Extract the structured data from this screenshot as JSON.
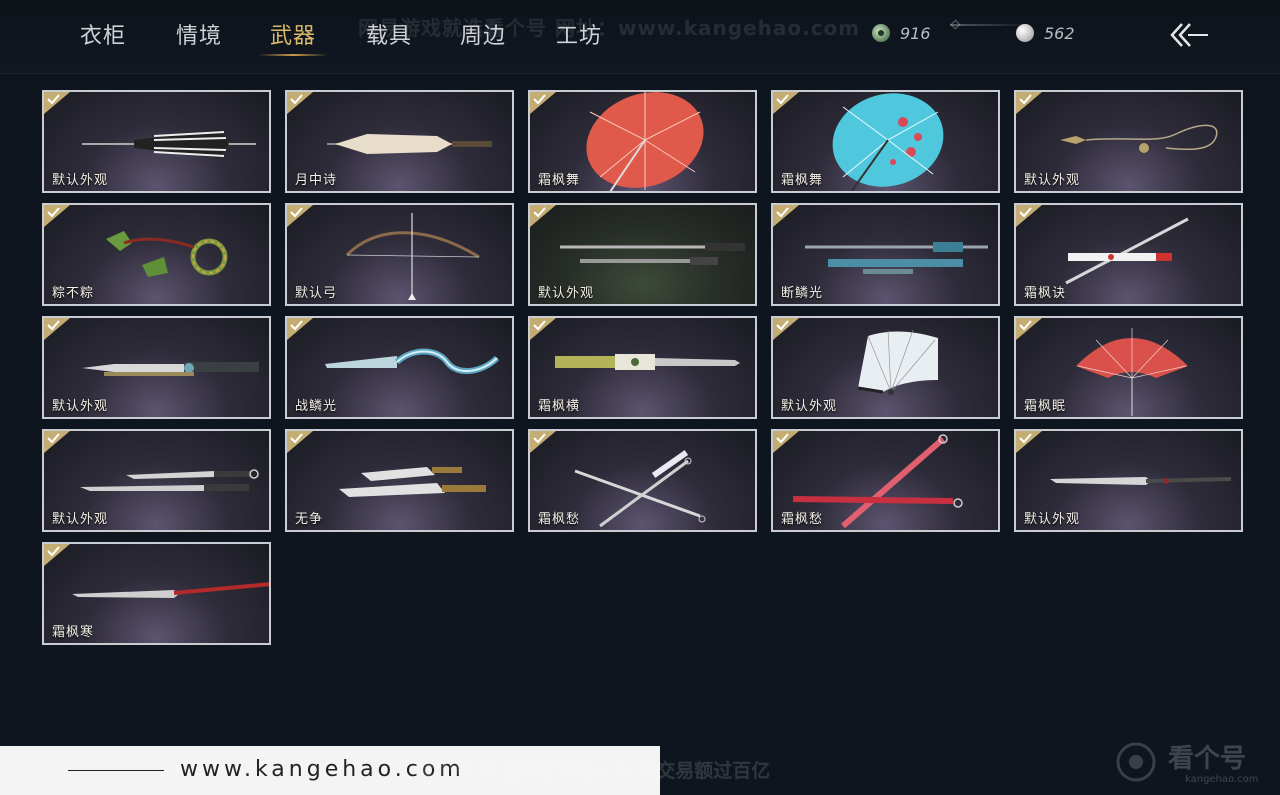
{
  "tabs": [
    {
      "label": "衣柜",
      "active": false
    },
    {
      "label": "情境",
      "active": false
    },
    {
      "label": "武器",
      "active": true
    },
    {
      "label": "载具",
      "active": false
    },
    {
      "label": "周边",
      "active": false
    },
    {
      "label": "工坊",
      "active": false
    }
  ],
  "watermark_top": "网易游戏就选看个号 网址：www.kangehao.com",
  "currency": {
    "jade": {
      "icon": "jade-coin-icon",
      "value": "916"
    },
    "silver": {
      "icon": "silver-coin-icon",
      "value": "562"
    }
  },
  "back_icon": "back-arrow-icon",
  "colors": {
    "accent": "#d9b86a",
    "check": "#c4ad72",
    "card_border": "#c9ccd1",
    "background": "#0f151f"
  },
  "items": [
    {
      "name": "默认外观",
      "icon": "umbrella-striped-icon",
      "owned": true
    },
    {
      "name": "月中诗",
      "icon": "umbrella-closed-white-icon",
      "owned": true
    },
    {
      "name": "霜枫舞",
      "icon": "umbrella-red-icon",
      "owned": true
    },
    {
      "name": "霜枫舞",
      "icon": "umbrella-blue-icon",
      "owned": true
    },
    {
      "name": "默认外观",
      "icon": "rope-dart-icon",
      "owned": true
    },
    {
      "name": "粽不粽",
      "icon": "zongzi-dart-icon",
      "owned": true
    },
    {
      "name": "默认弓",
      "icon": "bow-icon",
      "owned": true
    },
    {
      "name": "默认外观",
      "icon": "spear-pair-icon",
      "owned": true
    },
    {
      "name": "断鳞光",
      "icon": "spear-teal-icon",
      "owned": true
    },
    {
      "name": "霜枫诀",
      "icon": "spear-red-icon",
      "owned": true
    },
    {
      "name": "默认外观",
      "icon": "blade-long-icon",
      "owned": true
    },
    {
      "name": "战鳞光",
      "icon": "blade-dragon-icon",
      "owned": true
    },
    {
      "name": "霜枫横",
      "icon": "blade-jade-icon",
      "owned": true
    },
    {
      "name": "默认外观",
      "icon": "fan-white-icon",
      "owned": true
    },
    {
      "name": "霜枫眠",
      "icon": "fan-red-icon",
      "owned": true
    },
    {
      "name": "默认外观",
      "icon": "dual-sword-icon",
      "owned": true
    },
    {
      "name": "无争",
      "icon": "dual-sabre-icon",
      "owned": true
    },
    {
      "name": "霜枫愁",
      "icon": "cross-sword-white-icon",
      "owned": true
    },
    {
      "name": "霜枫愁",
      "icon": "cross-sword-red-icon",
      "owned": true
    },
    {
      "name": "默认外观",
      "icon": "long-blade-icon",
      "owned": true
    },
    {
      "name": "霜枫寒",
      "icon": "red-long-blade-icon",
      "owned": true
    }
  ],
  "footer": {
    "url": "www.kangehao.com",
    "slogan": "看个号 专业网易游戏八年 年交易额过百亿",
    "brand": "看个号",
    "brand_sub": "kangehao.com"
  }
}
